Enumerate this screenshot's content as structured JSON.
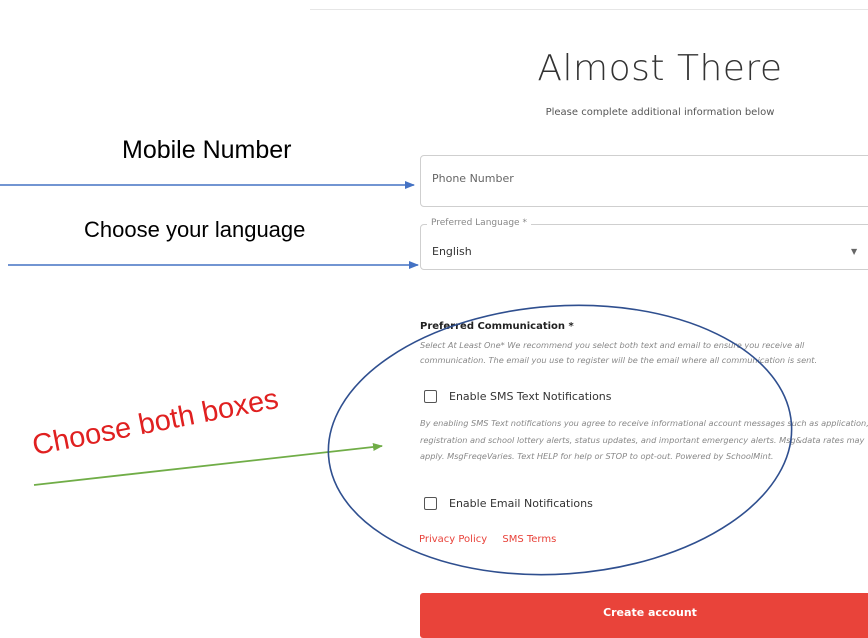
{
  "header": {
    "title": "Almost There",
    "subtitle": "Please complete additional information below"
  },
  "annotations": {
    "mobile_number": "Mobile Number",
    "choose_language": "Choose your language",
    "choose_both": "Choose both boxes"
  },
  "form": {
    "phone": {
      "placeholder": "Phone Number",
      "value": ""
    },
    "language": {
      "label": "Preferred Language *",
      "value": "English"
    },
    "communication": {
      "title": "Preferred Communication *",
      "description": "Select At Least One* We recommend you select both text and email to ensure you receive all communication. The email you use to register will be the email where all communication is sent.",
      "sms_label": "Enable SMS Text Notifications",
      "sms_disclaimer": "By enabling SMS Text notifications you agree to receive informational account messages such as application, registration and school lottery alerts, status updates, and important emergency alerts. Msg&data rates may apply. MsgFreqeVaries. Text HELP for help or STOP to opt-out. Powered by SchoolMint.",
      "email_label": "Enable Email Notifications"
    },
    "links": {
      "privacy": "Privacy Policy",
      "sms_terms": "SMS Terms"
    },
    "submit_label": "Create account"
  },
  "colors": {
    "accent": "#e9433a",
    "arrow_blue": "#4472c4",
    "arrow_green": "#70ad47",
    "ellipse": "#2f4f8f",
    "annotation_red": "#e02020"
  }
}
